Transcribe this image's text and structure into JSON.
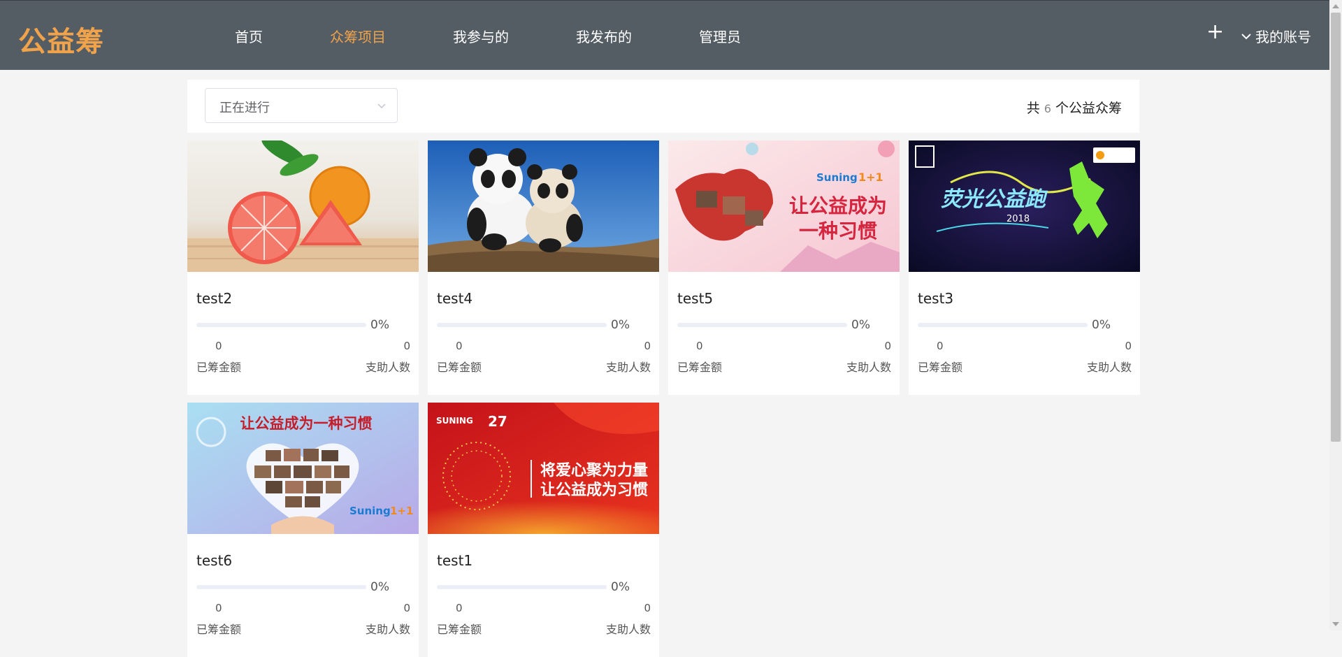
{
  "header": {
    "logo": "公益筹",
    "nav": [
      {
        "label": "首页"
      },
      {
        "label": "众筹项目",
        "active": true
      },
      {
        "label": "我参与的"
      },
      {
        "label": "我发布的"
      },
      {
        "label": "管理员"
      }
    ],
    "plus_label": "+",
    "account_label": "我的账号",
    "accent_color": "#f0a34a",
    "bar_color": "#545c64"
  },
  "filter": {
    "select_value": "正在进行",
    "count_prefix": "共",
    "count_value": "6",
    "count_suffix": "个公益众筹"
  },
  "projects": [
    {
      "title": "test2",
      "percent_text": "0%",
      "progress": 0,
      "raised": "0",
      "raised_label": "已筹金额",
      "backers": "0",
      "backers_label": "支助人数",
      "image_text": ""
    },
    {
      "title": "test4",
      "percent_text": "0%",
      "progress": 0,
      "raised": "0",
      "raised_label": "已筹金额",
      "backers": "0",
      "backers_label": "支助人数",
      "image_text": ""
    },
    {
      "title": "test5",
      "percent_text": "0%",
      "progress": 0,
      "raised": "0",
      "raised_label": "已筹金额",
      "backers": "0",
      "backers_label": "支助人数",
      "image_text": "让公益成为一种习惯"
    },
    {
      "title": "test3",
      "percent_text": "0%",
      "progress": 0,
      "raised": "0",
      "raised_label": "已筹金额",
      "backers": "0",
      "backers_label": "支助人数",
      "image_text": "荧光公益跑"
    },
    {
      "title": "test6",
      "percent_text": "0%",
      "progress": 0,
      "raised": "0",
      "raised_label": "已筹金额",
      "backers": "0",
      "backers_label": "支助人数",
      "image_text": "让公益成为一种习惯"
    },
    {
      "title": "test1",
      "percent_text": "0%",
      "progress": 0,
      "raised": "0",
      "raised_label": "已筹金额",
      "backers": "0",
      "backers_label": "支助人数",
      "image_text": "将爱心聚为力量 让公益成为习惯"
    }
  ]
}
